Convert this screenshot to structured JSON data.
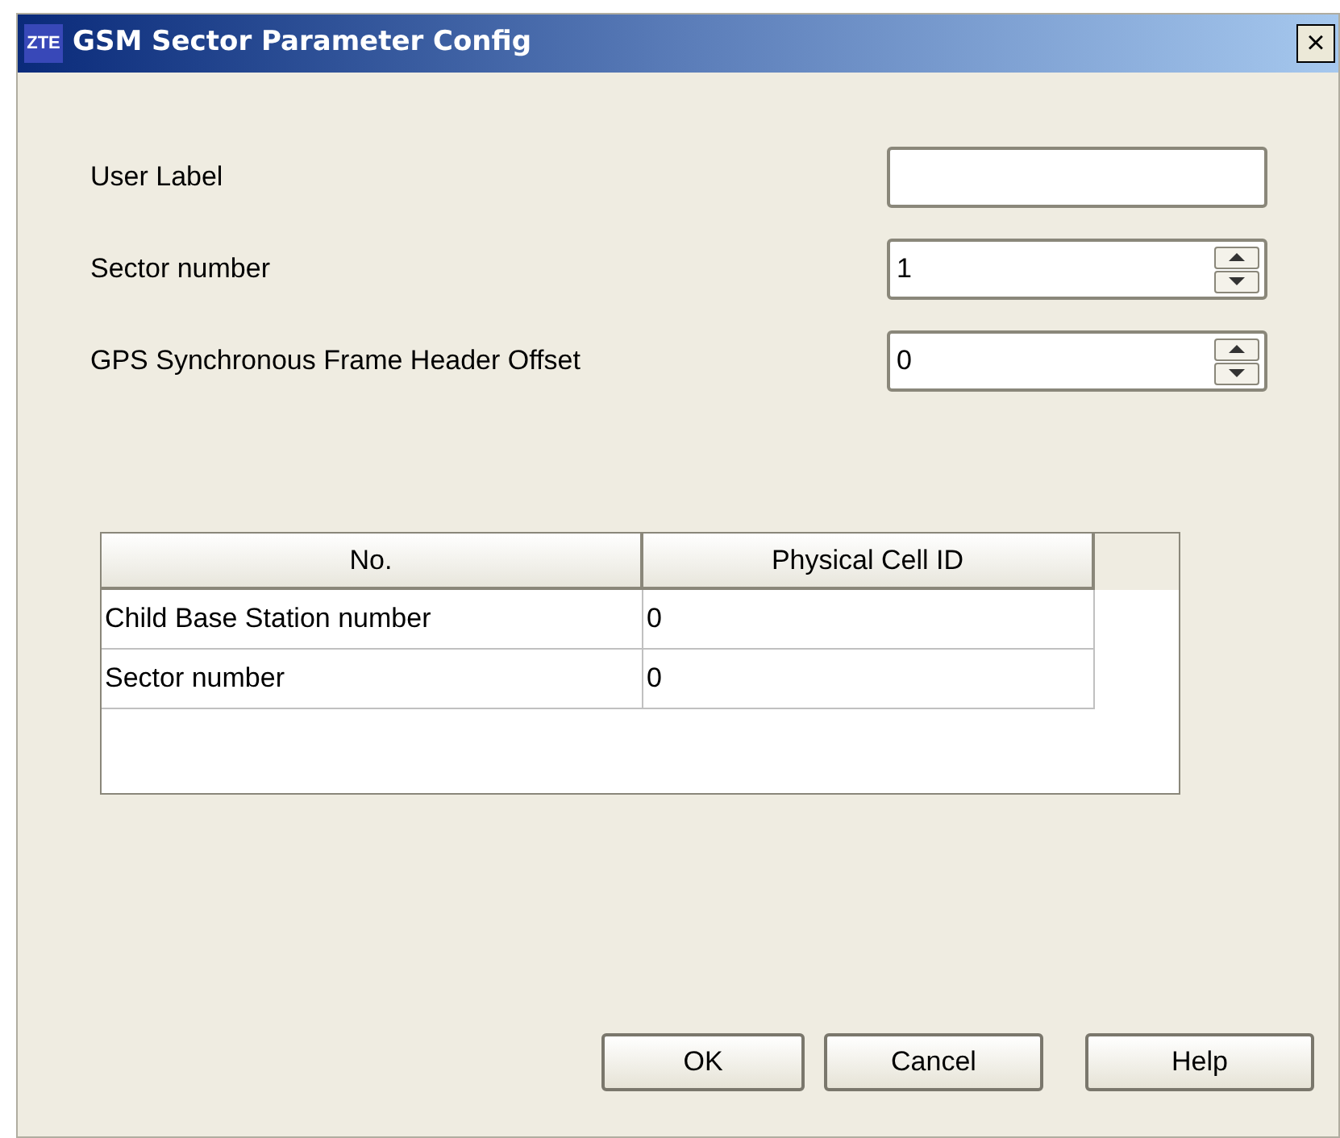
{
  "window": {
    "title": "GSM Sector Parameter Config",
    "logo": "ZTE",
    "close": "×"
  },
  "fields": [
    {
      "kind": "text",
      "label": "User Label"
    },
    {
      "kind": "spinner",
      "label": "Sector number",
      "value": "1"
    },
    {
      "kind": "spinner",
      "label": "GPS Synchronous Frame Header Offset",
      "value": "0"
    }
  ],
  "table": {
    "columns": [
      "No.",
      "Physical Cell ID"
    ],
    "rows": [
      [
        "Child Base Station number",
        "0"
      ],
      [
        "Sector number",
        "0"
      ]
    ]
  },
  "buttons": [
    "OK",
    "Cancel",
    "Help"
  ]
}
